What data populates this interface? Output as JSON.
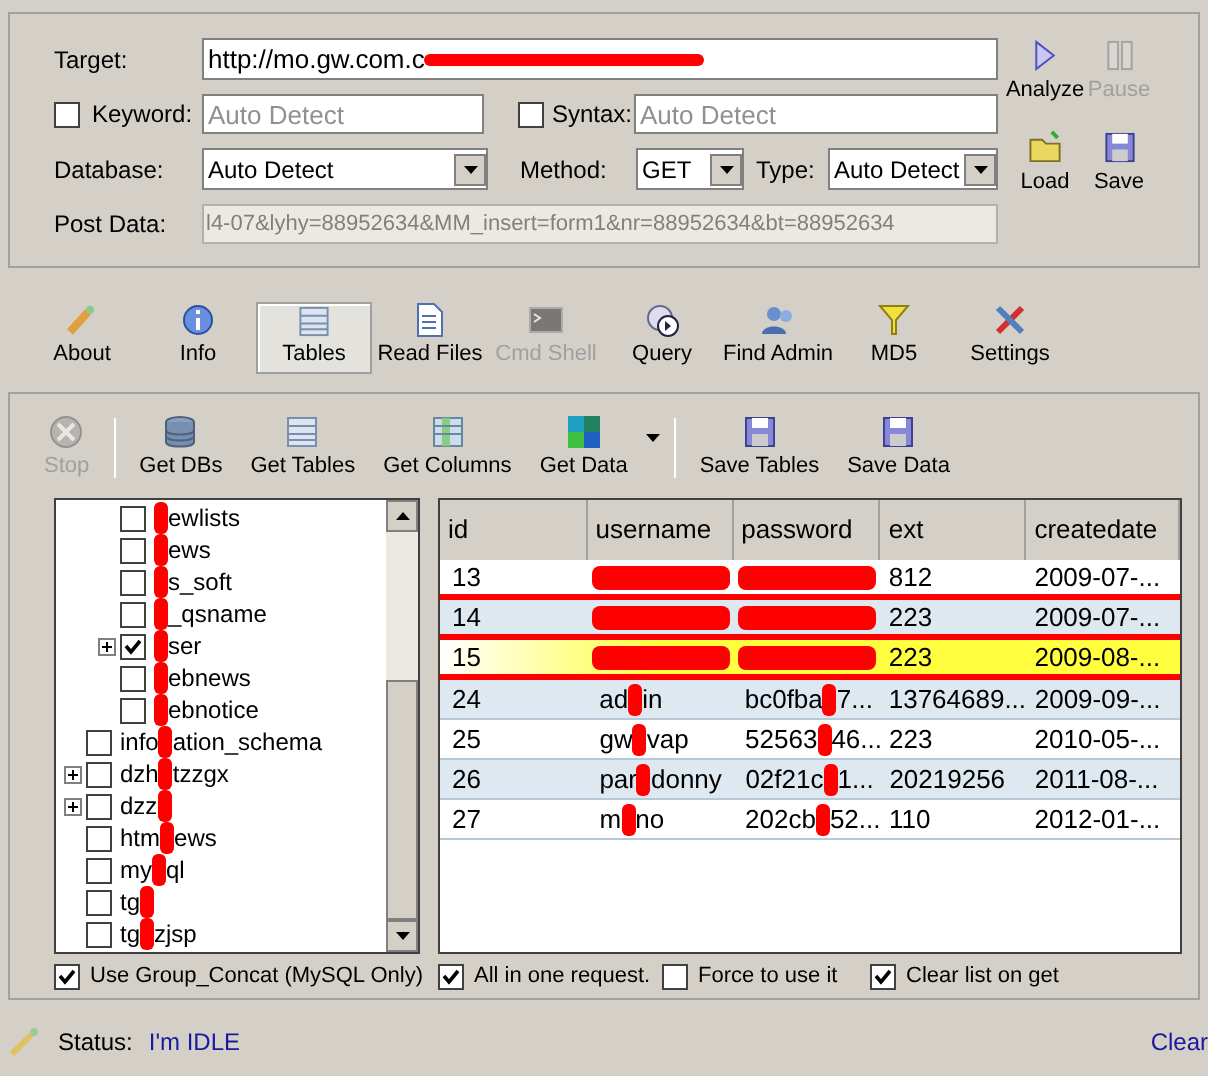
{
  "target": {
    "label": "Target:",
    "value": "http://mo.gw.com.c",
    "redacted": true
  },
  "keyword": {
    "label": "Keyword:",
    "checked": false,
    "placeholder": "Auto Detect"
  },
  "syntax": {
    "label": "Syntax:",
    "checked": false,
    "placeholder": "Auto Detect"
  },
  "database": {
    "label": "Database:",
    "value": "Auto Detect"
  },
  "method": {
    "label": "Method:",
    "value": "GET"
  },
  "type": {
    "label": "Type:",
    "value": "Auto Detect"
  },
  "post_data": {
    "label": "Post Data:",
    "value": "l4-07&lyhy=88952634&MM_insert=form1&nr=88952634&bt=88952634"
  },
  "actions": [
    {
      "label": "Analyze",
      "kind": "analyze",
      "disabled": false
    },
    {
      "label": "Pause",
      "kind": "pause",
      "disabled": true
    },
    {
      "label": "Load",
      "kind": "load",
      "disabled": false
    },
    {
      "label": "Save",
      "kind": "save",
      "disabled": false
    }
  ],
  "tabs": [
    {
      "label": "About",
      "kind": "about",
      "selected": false,
      "disabled": false
    },
    {
      "label": "Info",
      "kind": "info",
      "selected": false,
      "disabled": false
    },
    {
      "label": "Tables",
      "kind": "tables",
      "selected": true,
      "disabled": false
    },
    {
      "label": "Read Files",
      "kind": "files",
      "selected": false,
      "disabled": false
    },
    {
      "label": "Cmd Shell",
      "kind": "shell",
      "selected": false,
      "disabled": true
    },
    {
      "label": "Query",
      "kind": "query",
      "selected": false,
      "disabled": false
    },
    {
      "label": "Find Admin",
      "kind": "admin",
      "selected": false,
      "disabled": false
    },
    {
      "label": "MD5",
      "kind": "md5",
      "selected": false,
      "disabled": false
    },
    {
      "label": "Settings",
      "kind": "settings",
      "selected": false,
      "disabled": false
    }
  ],
  "tools": [
    {
      "label": "Stop",
      "kind": "stop",
      "disabled": true,
      "separator_after": true
    },
    {
      "label": "Get DBs",
      "kind": "dbs",
      "disabled": false
    },
    {
      "label": "Get Tables",
      "kind": "tables",
      "disabled": false
    },
    {
      "label": "Get Columns",
      "kind": "columns",
      "disabled": false
    },
    {
      "label": "Get Data",
      "kind": "data",
      "disabled": false,
      "dropdown": true,
      "separator_after": true
    },
    {
      "label": "Save Tables",
      "kind": "save",
      "disabled": false
    },
    {
      "label": "Save Data",
      "kind": "save",
      "disabled": false
    }
  ],
  "tree": [
    {
      "children": [
        {
          "tail": "ewlists",
          "checked": false
        },
        {
          "tail": "ews",
          "checked": false
        },
        {
          "tail": "s_soft",
          "checked": false
        },
        {
          "tail": "_qsname",
          "checked": false
        },
        {
          "tail": "ser",
          "checked": true,
          "collapsed": true
        },
        {
          "tail": "ebnews",
          "checked": false
        },
        {
          "tail": "ebnotice",
          "checked": false
        }
      ]
    },
    {
      "head": "info",
      "tail": "ation_schema",
      "checked": false
    },
    {
      "head": "dzh",
      "tail": "tzzgx",
      "checked": false,
      "collapsed": true
    },
    {
      "head": "dzz",
      "checked": false,
      "collapsed": true
    },
    {
      "head": "htm",
      "tail": "ews",
      "checked": false
    },
    {
      "head": "my",
      "tail": "ql",
      "checked": false
    },
    {
      "head": "tg",
      "checked": false
    },
    {
      "head": "tg",
      "tail": "zjsp",
      "checked": false
    }
  ],
  "tree_option": {
    "label": "Use Group_Concat (MySQL Only)",
    "checked": true
  },
  "grid": {
    "columns": [
      "id",
      "username",
      "password",
      "ext",
      "createdate"
    ],
    "rows": [
      {
        "id": "13",
        "redacted": true,
        "ext": "812",
        "createdate": "2009-07-...",
        "selected": false
      },
      {
        "id": "14",
        "redacted": true,
        "ext": "223",
        "createdate": "2009-07-...",
        "selected": false
      },
      {
        "id": "15",
        "redacted": true,
        "ext": "223",
        "createdate": "2009-08-...",
        "selected": true
      },
      {
        "id": "24",
        "username": {
          "head": "ad",
          "tail": "in"
        },
        "password": {
          "head": "bc0fba",
          "tail": "7..."
        },
        "ext": "13764689...",
        "createdate": "2009-09-...",
        "selected": false
      },
      {
        "id": "25",
        "username": {
          "head": "gw",
          "tail": "vap"
        },
        "password": {
          "head": "52563",
          "tail": "46..."
        },
        "ext": "223",
        "createdate": "2010-05-...",
        "selected": false
      },
      {
        "id": "26",
        "username": {
          "head": "par",
          "tail": "donny"
        },
        "password": {
          "head": "02f21c",
          "tail": "1..."
        },
        "ext": "20219256",
        "createdate": "2011-08-...",
        "selected": false
      },
      {
        "id": "27",
        "username": {
          "head": "m",
          "tail": "no"
        },
        "password": {
          "head": "202cb",
          "tail": "52..."
        },
        "ext": "110",
        "createdate": "2012-01-...",
        "selected": false
      }
    ]
  },
  "grid_options": [
    {
      "label": "All in one request.",
      "checked": true
    },
    {
      "label": "Force to use it",
      "checked": false
    },
    {
      "label": "Clear list on get",
      "checked": true
    }
  ],
  "status": {
    "label": "Status:",
    "value": "I'm IDLE"
  },
  "clear_link": "Clear"
}
